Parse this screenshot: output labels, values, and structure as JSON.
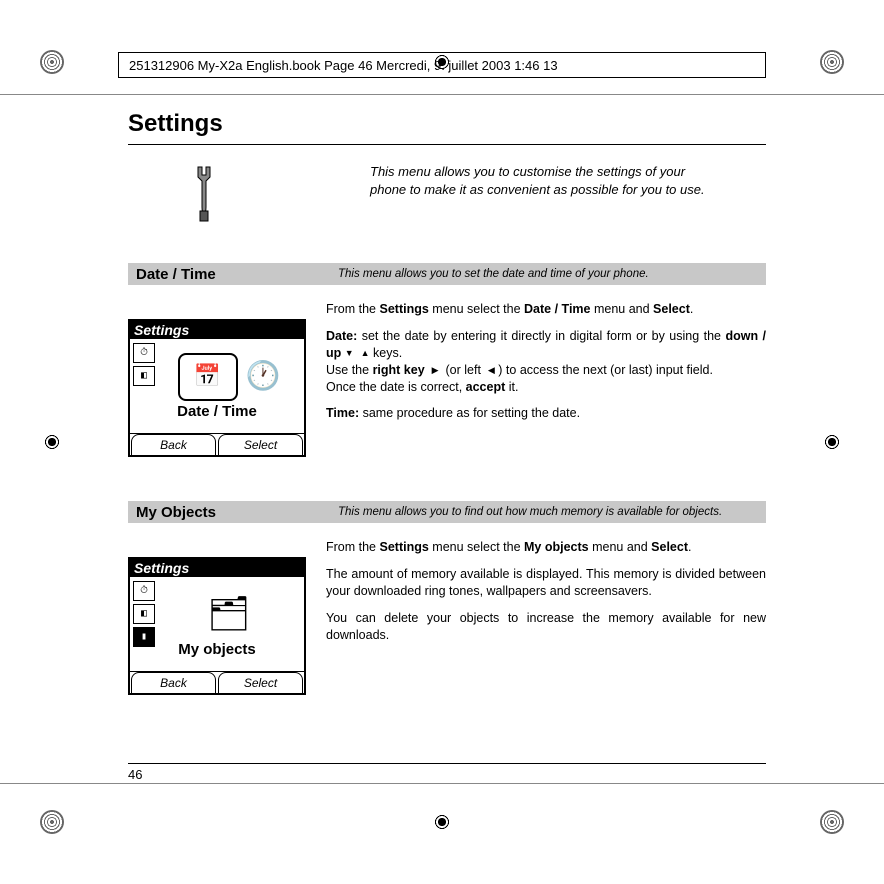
{
  "header": "251312906 My-X2a English.book  Page 46  Mercredi, 9. juillet 2003  1:46 13",
  "pageNumber": "46",
  "title": "Settings",
  "intro": "This menu allows you to customise the settings of your phone to make it as convenient as possible for you to use.",
  "sections": [
    {
      "title": "Date / Time",
      "desc": "This menu allows you to set the date and time of your phone.",
      "screenshot": {
        "header": "Settings",
        "mainLabel": "Date / Time",
        "softkeyLeft": "Back",
        "softkeyRight": "Select"
      },
      "body": {
        "intro_pre": "From the ",
        "intro_b1": "Settings",
        "intro_mid1": " menu select the ",
        "intro_b2": "Date / Time",
        "intro_mid2": " menu and ",
        "intro_b3": "Select",
        "intro_post": ".",
        "date_label": "Date:",
        "date_t1": " set the date by entering it directly in digital form or by using the ",
        "date_b1": "down / up",
        "date_t2": " keys.",
        "use_t1": "Use the ",
        "use_b1": "right key",
        "use_t2": " (or left ",
        "use_t3": " ) to access the next (or last) input field.",
        "acc_t1": "Once the date is correct, ",
        "acc_b1": "accept",
        "acc_t2": " it.",
        "time_label": "Time:",
        "time_text": " same procedure as for setting the date."
      }
    },
    {
      "title": "My Objects",
      "desc": "This menu allows you to find out how much memory is available for objects.",
      "screenshot": {
        "header": "Settings",
        "mainLabel": "My objects",
        "softkeyLeft": "Back",
        "softkeyRight": "Select"
      },
      "body": {
        "intro_pre": "From the ",
        "intro_b1": "Settings",
        "intro_mid1": " menu select the ",
        "intro_b2": "My objects",
        "intro_mid2": " menu and ",
        "intro_b3": "Select",
        "intro_post": ".",
        "p2": "The amount of memory available is displayed. This memory is divided between your downloaded ring tones, wallpapers and screensavers.",
        "p3": "You can delete your objects to increase the memory available for new downloads."
      }
    }
  ]
}
